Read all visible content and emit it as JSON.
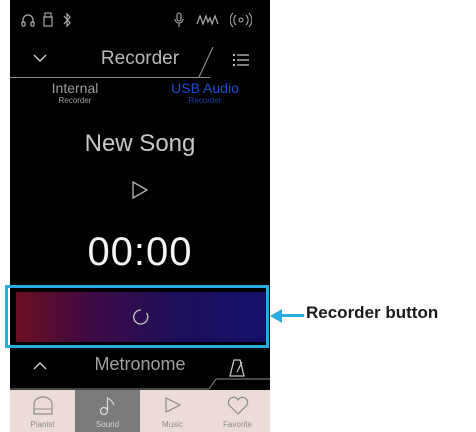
{
  "status_bar": {
    "icons": [
      "headphones-icon",
      "usb-device-icon",
      "bluetooth-icon",
      "microphone-icon",
      "audio-signal-icon",
      "wireless-icon"
    ]
  },
  "header": {
    "title": "Recorder"
  },
  "source_toggle": {
    "internal": {
      "label": "Internal",
      "sublabel": "Recorder",
      "selected": false
    },
    "usb": {
      "label": "USB Audio",
      "sublabel": "Recorder",
      "selected": true
    }
  },
  "song": {
    "title": "New Song"
  },
  "time": "00:00",
  "metronome": {
    "title": "Metronome"
  },
  "tabs": [
    {
      "label": "Pianist",
      "icon": "piano-icon",
      "active": false
    },
    {
      "label": "Sound",
      "icon": "music-note-icon",
      "active": true
    },
    {
      "label": "Music",
      "icon": "play-icon",
      "active": false
    },
    {
      "label": "Favorite",
      "icon": "heart-icon",
      "active": false
    }
  ],
  "annotation": {
    "label": "Recorder button"
  },
  "colors": {
    "accent_blue": "#1a4fcf",
    "callout_blue": "#29aae1",
    "tab_bar": "#ecdcd7",
    "tab_active": "#7b7b7b"
  }
}
